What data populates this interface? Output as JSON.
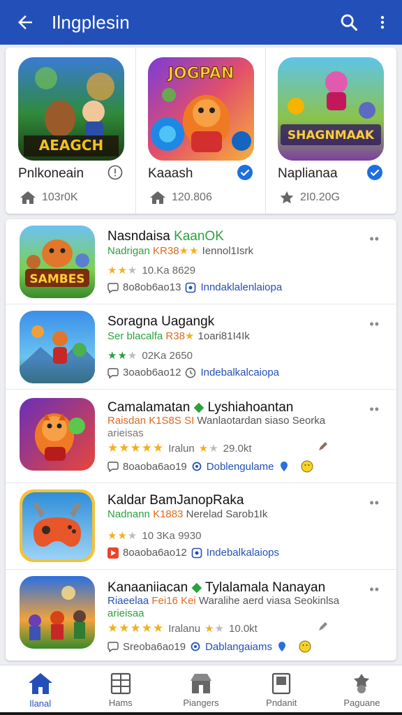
{
  "appbar": {
    "title": "Ilngplesin",
    "back_icon": "arrow-left-icon",
    "search_icon": "search-icon",
    "menu_icon": "more-vert-icon"
  },
  "featured": [
    {
      "art_text": "AEAGCH",
      "name": "Pnlkoneain",
      "meta": "103r0K",
      "badge": "info",
      "meta_icon": "home-icon"
    },
    {
      "art_text": "JOGPAN",
      "name": "Kaaash",
      "meta": "120.806",
      "badge": "check",
      "meta_icon": "home-icon"
    },
    {
      "art_text": "SHAGNMAAK",
      "name": "Naplianaa",
      "meta": "2I0.20G",
      "badge": "check",
      "meta_icon": "star-icon"
    }
  ],
  "list": [
    {
      "title_a": "Nasndaisa ",
      "title_b": "KaanOK",
      "sub_a": "Nadrigan ",
      "sub_b": "KR38",
      "sub_c": "  Iennol1Isrk",
      "rating": "10.Ka 8629",
      "code": "8o8ob6ao13",
      "link": "Inndaklalenlaiopa",
      "icon_text": "SAMBES"
    },
    {
      "title_a": "Soragna Uagangk",
      "title_b": "",
      "sub_a": "Ser blacalfa ",
      "sub_b": "R38",
      "sub_c": "  1oari81I4Ik",
      "rating": "02Ka 2650",
      "code": "3oaob6ao12",
      "link": "Indebalkalcaiopa",
      "icon_text": ""
    },
    {
      "title_a": "Camalamatan ",
      "title_b": "Lyshiahoantan",
      "sub_a": "Raisdan ",
      "sub_b": "K1S8S SI",
      "sub_c": " Wanlaotardan siaso Seorka",
      "sub2": "arieisas",
      "rating_text": "Iralun",
      "rating_num": "29.0kt",
      "code": "8oaoba6ao19",
      "link": "Doblengulame",
      "icon_text": ""
    },
    {
      "title_a": "Kaldar BamJanopRaka",
      "title_b": "",
      "sub_a": "Nadnann ",
      "sub_b": "K1883",
      "sub_c": " Nerelad Sarob1Ik",
      "rating": "10 3Ka 9930",
      "code": "8oaoba6ao12",
      "link": "Indebalkalaiops",
      "icon_text": ""
    },
    {
      "title_a": "Kanaaniiacan ",
      "title_b": "Tylalamala Nanayan",
      "sub_a": "Riaeelaa ",
      "sub_b": "Fei16 Kei",
      "sub_c": " Waralihe aerd viasa Seokinlsa",
      "sub2": "arieisaa",
      "rating_text": "Iralanu",
      "rating_num": "10.0kt",
      "code": "Sreoba6ao19",
      "link": "Dablangaiams",
      "icon_text": ""
    }
  ],
  "bottomnav": [
    {
      "label": "Ilanal",
      "icon": "home-icon",
      "active": true
    },
    {
      "label": "Hams",
      "icon": "grid-icon",
      "active": false
    },
    {
      "label": "Piangers",
      "icon": "store-icon",
      "active": false
    },
    {
      "label": "Pndanit",
      "icon": "book-icon",
      "active": false
    },
    {
      "label": "Paguane",
      "icon": "badge-icon",
      "active": false
    }
  ],
  "colors": {
    "primary": "#2350b8",
    "green": "#2aa23c",
    "orange": "#e06a1e",
    "star": "#f2b01e"
  }
}
